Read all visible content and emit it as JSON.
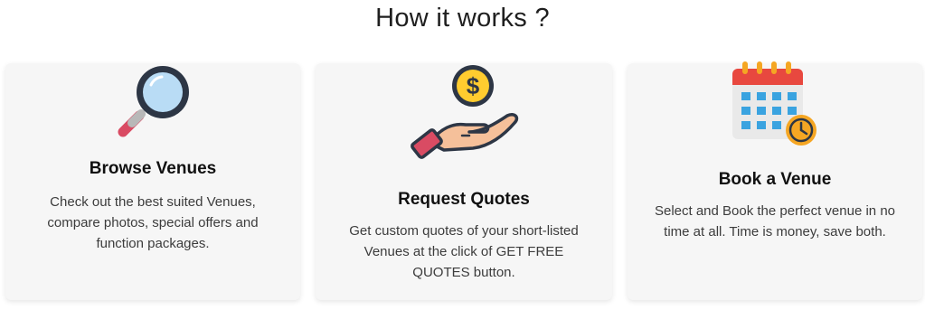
{
  "section": {
    "title": "How it works ?"
  },
  "cards": [
    {
      "icon": "magnifying-glass-icon",
      "title": "Browse Venues",
      "description": "Check out the best suited Venues, compare photos, special offers and function packages."
    },
    {
      "icon": "hand-dollar-coin-icon",
      "title": "Request Quotes",
      "description": "Get custom quotes of your short-listed Venues at the click of GET FREE QUOTES button."
    },
    {
      "icon": "calendar-clock-icon",
      "title": "Book a Venue",
      "description": "Select and Book the perfect venue in no time at all. Time is money, save both."
    }
  ],
  "colors": {
    "card_background": "#f6f6f6",
    "coin": "#ffcc2f",
    "calendar_header": "#e8483f",
    "calendar_cell": "#3aa3e0",
    "clock": "#f5a623",
    "hand": "#f5c09a",
    "cuff": "#d94b63"
  }
}
